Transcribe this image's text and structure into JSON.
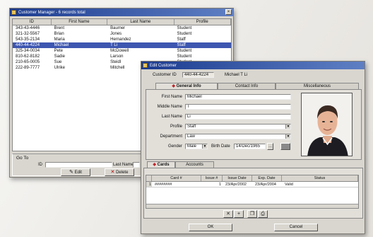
{
  "list_window": {
    "title": "Customer Manager - 6 records total",
    "close": "×",
    "columns": [
      "ID",
      "First Name",
      "Last Name",
      "Profile"
    ],
    "rows": [
      [
        "343-43-4446",
        "Brent",
        "Baumer",
        "Student"
      ],
      [
        "321-32-5567",
        "Brian",
        "Jones",
        "Student"
      ],
      [
        "543-35-2134",
        "Maria",
        "Hernandez",
        "Staff"
      ],
      [
        "440-44-4224",
        "Michael",
        "T Li",
        "Staff"
      ],
      [
        "325-34-0034",
        "Pete",
        "McDowell",
        "Student"
      ],
      [
        "810-62-8182",
        "Sadie",
        "Larson",
        "Student"
      ],
      [
        "210-65-0005",
        "Sue",
        "Steidl",
        "Student"
      ],
      [
        "222-89-7777",
        "Ulrike",
        "Mitchell",
        "Staff"
      ]
    ],
    "selected_row": 3,
    "goto_label": "Go To",
    "id_label": "ID",
    "lastname_label": "Last Name",
    "edit_button": "Edit",
    "delete_button": "Delete"
  },
  "edit_window": {
    "title": "Edit Customer",
    "customer_id_label": "Customer ID",
    "customer_id": "440-44-4224",
    "customer_name": "Michael T Li",
    "tabs": [
      "General Info",
      "Contact Info",
      "Miscellaneous"
    ],
    "active_tab": 0,
    "form": {
      "first_name_label": "First Name",
      "first_name": "Michael",
      "middle_name_label": "Middle Name",
      "middle_name": "T",
      "last_name_label": "Last Name",
      "last_name": "Li",
      "profile_label": "Profile",
      "profile": "Staff",
      "department_label": "Department",
      "department": "Law",
      "gender_label": "Gender",
      "gender": "Male",
      "birth_date_label": "Birth Date",
      "birth_date": "14/Dec/1965"
    },
    "sub_tabs": [
      "Cards",
      "Accounts"
    ],
    "active_sub_tab": 0,
    "cards_columns": [
      "Card #",
      "Issue #",
      "Issue Date",
      "Exp. Date",
      "Status"
    ],
    "cards_rows": [
      [
        "1",
        "########",
        "1",
        "23/Apr/2002",
        "23/Apr/2004",
        "Valid"
      ]
    ],
    "ok_button": "OK",
    "cancel_button": "Cancel",
    "toolbar_icons": [
      "delete-icon",
      "add-icon",
      "copy-icon",
      "print-icon"
    ]
  },
  "colors": {
    "titlebar": "#1b3b8f",
    "selection": "#3d56b0",
    "window": "#d9d6cf",
    "tab_marker": "#c0262b"
  }
}
